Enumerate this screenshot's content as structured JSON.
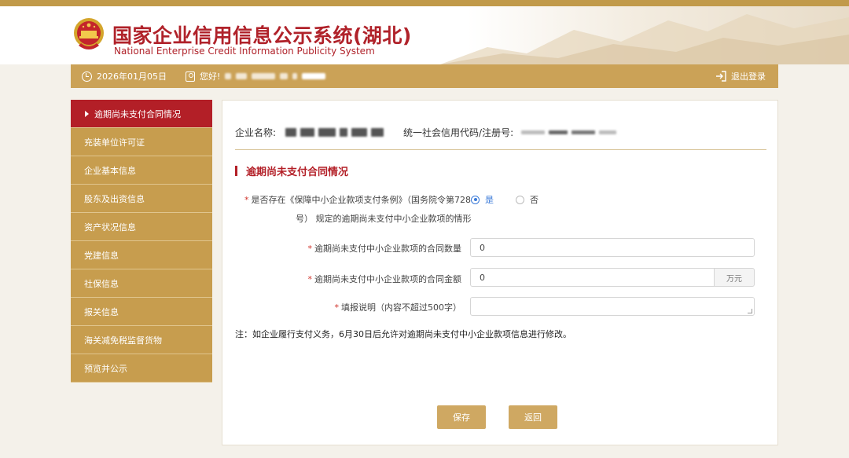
{
  "header": {
    "title_zh": "国家企业信用信息公示系统(湖北)",
    "title_en": "National Enterprise Credit Information Publicity System"
  },
  "infobar": {
    "date": "2026年01月05日",
    "greeting": "您好!",
    "logout": "退出登录"
  },
  "sidebar": {
    "items": [
      {
        "label": "逾期尚未支付合同情况",
        "active": true
      },
      {
        "label": "充装单位许可证"
      },
      {
        "label": "企业基本信息"
      },
      {
        "label": "股东及出资信息"
      },
      {
        "label": "资产状况信息"
      },
      {
        "label": "党建信息"
      },
      {
        "label": "社保信息"
      },
      {
        "label": "报关信息"
      },
      {
        "label": "海关减免税监督货物"
      },
      {
        "label": "预览并公示"
      }
    ]
  },
  "main": {
    "company_name_label": "企业名称:",
    "credit_code_label": "统一社会信用代码/注册号:",
    "section_title": "逾期尚未支付合同情况",
    "question_line1": "是否存在《保障中小企业款项支付条例》（国务院令第728",
    "question_line2": "号） 规定的逾期尚未支付中小企业款项的情形",
    "radio_yes": "是",
    "radio_no": "否",
    "count_label": "逾期尚未支付中小企业款项的合同数量",
    "count_value": "0",
    "amount_label": "逾期尚未支付中小企业款项的合同金额",
    "amount_value": "0",
    "amount_unit": "万元",
    "remark_label": "填报说明（内容不超过500字）",
    "remark_value": "",
    "note": "注：如企业履行支付义务，6月30日后允许对逾期尚未支付中小企业款项信息进行修改。",
    "save_button": "保存",
    "back_button": "返回"
  },
  "colors": {
    "accent_gold": "#cba257",
    "active_red": "#b31f27",
    "radio_blue": "#3a7ad8"
  }
}
